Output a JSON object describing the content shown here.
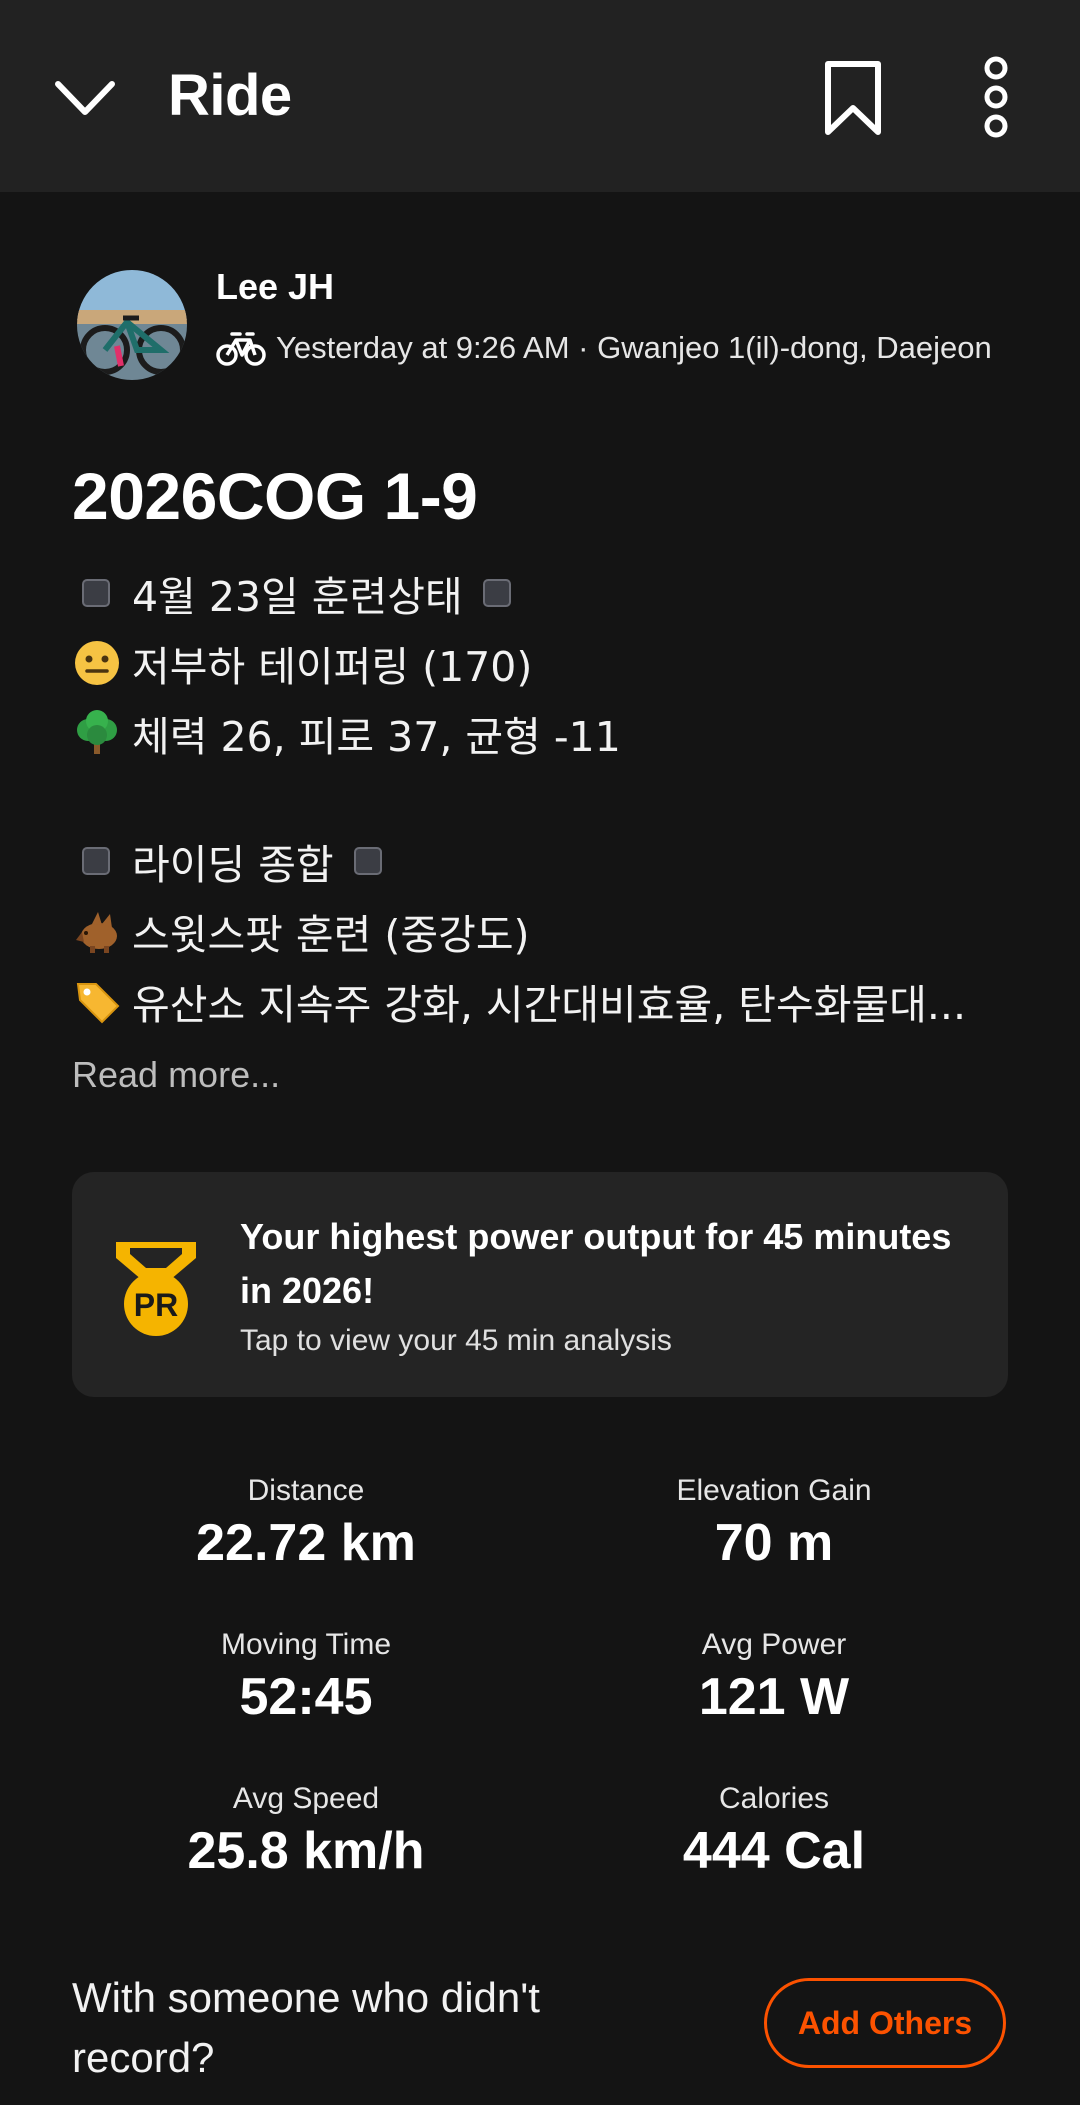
{
  "header": {
    "title": "Ride",
    "icons": {
      "back": "chevron-down-icon",
      "save": "bookmark-icon",
      "more": "more-vertical-icon"
    }
  },
  "athlete": {
    "name": "Lee JH",
    "meta": "Yesterday at 9:26 AM · Gwanjeo 1(il)-dong, Daejeon",
    "activity_icon": "bike-icon"
  },
  "activity": {
    "title": "2026COG 1-9",
    "description": {
      "line1": "4월 23일 훈련상태",
      "line2": "저부하 테이퍼링 (170)",
      "line3": "체력 26, 피로 37, 균형 -11",
      "line4": "라이딩 종합",
      "line5": "스윗스팟 훈련 (중강도)",
      "line6": "유산소 지속주 강화, 시간대비효율, 탄수화물대..."
    },
    "read_more": "Read more..."
  },
  "pr_card": {
    "title": "Your highest power output for 45 minutes in 2026!",
    "subtitle": "Tap to view your 45 min analysis",
    "badge_text": "PR",
    "icon": "pr-medal-icon"
  },
  "stats": [
    {
      "label": "Distance",
      "value": "22.72 km"
    },
    {
      "label": "Elevation Gain",
      "value": "70 m"
    },
    {
      "label": "Moving Time",
      "value": "52:45"
    },
    {
      "label": "Avg Power",
      "value": "121 W"
    },
    {
      "label": "Avg Speed",
      "value": "25.8 km/h"
    },
    {
      "label": "Calories",
      "value": "444 Cal"
    }
  ],
  "group": {
    "prompt": "With someone who didn't record?",
    "button_label": "Add Others"
  },
  "colors": {
    "background": "#141414",
    "header_bg": "#222222",
    "card_bg": "#242424",
    "accent": "#fc5200",
    "pr_gold": "#f5b400"
  }
}
